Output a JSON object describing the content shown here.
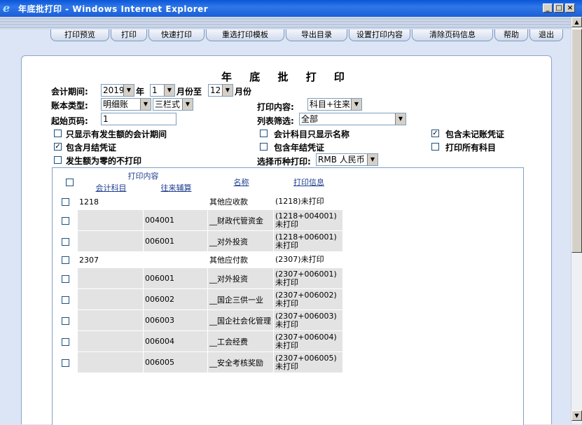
{
  "window": {
    "title": "年底批打印 - Windows Internet Explorer"
  },
  "toolbar": [
    "打印预览",
    "打印",
    "快速打印",
    "重选打印模板",
    "导出目录",
    "设置打印内容",
    "清除页码信息",
    "帮助",
    "退出"
  ],
  "form": {
    "title": "年 底 批 打 印",
    "period_label": "会计期间:",
    "year": "2019",
    "year_unit": "年",
    "month_from": "1",
    "month_to_text": "月份至",
    "month_to": "12",
    "month_unit": "月份",
    "ledger_label": "账本类型:",
    "ledger_type": "明细账",
    "ledger_format": "三栏式",
    "print_content_label": "打印内容:",
    "print_content": "科目+往来",
    "start_page_label": "起始页码:",
    "start_page": "1",
    "list_filter_label": "列表筛选:",
    "list_filter": "全部",
    "currency_label": "选择币种打印:",
    "currency": "RMB 人民币"
  },
  "options": [
    {
      "label": "只显示有发生额的会计期间",
      "checked": false
    },
    {
      "label": "会计科目只显示名称",
      "checked": false
    },
    {
      "label": "包含未记账凭证",
      "checked": true
    },
    {
      "label": "包含月结凭证",
      "checked": true
    },
    {
      "label": "包含年结凭证",
      "checked": false
    },
    {
      "label": "打印所有科目",
      "checked": false
    },
    {
      "label": "发生额为零的不打印",
      "checked": false
    }
  ],
  "grid": {
    "header_group": "打印内容",
    "columns": [
      "会计科目",
      "往来辅算",
      "名称",
      "打印信息"
    ],
    "rows": [
      {
        "account": "1218",
        "aux": "",
        "name": "其他应收款",
        "info": "(1218)未打印"
      },
      {
        "account": "",
        "aux": "004001",
        "name": "__财政代管资金",
        "info": "(1218+004001)未打印"
      },
      {
        "account": "",
        "aux": "006001",
        "name": "__对外投资",
        "info": "(1218+006001)未打印"
      },
      {
        "account": "2307",
        "aux": "",
        "name": "其他应付款",
        "info": "(2307)未打印"
      },
      {
        "account": "",
        "aux": "006001",
        "name": "__对外投资",
        "info": "(2307+006001)未打印"
      },
      {
        "account": "",
        "aux": "006002",
        "name": "__国企三供一业",
        "info": "(2307+006002)未打印"
      },
      {
        "account": "",
        "aux": "006003",
        "name": "__国企社会化管理",
        "info": "(2307+006003)未打印"
      },
      {
        "account": "",
        "aux": "006004",
        "name": "__工会经费",
        "info": "(2307+006004)未打印"
      },
      {
        "account": "",
        "aux": "006005",
        "name": "__安全考核奖励",
        "info": "(2307+006005)未打印"
      }
    ]
  }
}
